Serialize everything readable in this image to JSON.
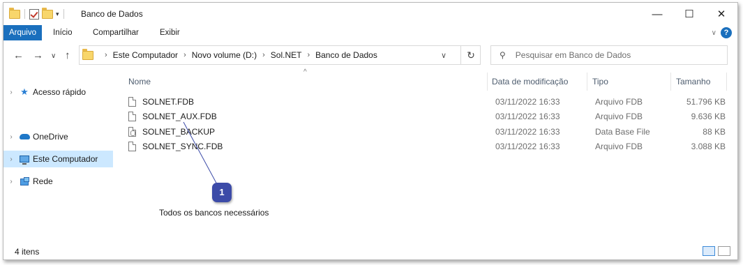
{
  "window": {
    "title": "Banco de Dados",
    "minimize_glyph": "—",
    "maximize_glyph": "☐",
    "close_glyph": "✕"
  },
  "ribbon": {
    "tabs": [
      "Arquivo",
      "Início",
      "Compartilhar",
      "Exibir"
    ],
    "active_tab": "Arquivo",
    "help_label": "?"
  },
  "nav": {
    "back_glyph": "←",
    "forward_glyph": "→",
    "recent_glyph": "∨",
    "up_glyph": "↑",
    "refresh_glyph": "↻",
    "breadcrumb": [
      "Este Computador",
      "Novo volume (D:)",
      "Sol.NET",
      "Banco de Dados"
    ],
    "search_placeholder": "Pesquisar em Banco de Dados"
  },
  "sidebar": {
    "items": [
      {
        "label": "Acesso rápido",
        "icon": "star-icon",
        "selected": false
      },
      {
        "label": "OneDrive",
        "icon": "cloud-icon",
        "selected": false
      },
      {
        "label": "Este Computador",
        "icon": "monitor-icon",
        "selected": true
      },
      {
        "label": "Rede",
        "icon": "network-icon",
        "selected": false
      }
    ]
  },
  "columns": {
    "name": "Nome",
    "date": "Data de modificação",
    "type": "Tipo",
    "size": "Tamanho"
  },
  "files": [
    {
      "name": "SOLNET.FDB",
      "date": "03/11/2022 16:33",
      "type": "Arquivo FDB",
      "size": "51.796 KB",
      "icon": "file-icon"
    },
    {
      "name": "SOLNET_AUX.FDB",
      "date": "03/11/2022 16:33",
      "type": "Arquivo FDB",
      "size": "9.636 KB",
      "icon": "file-icon"
    },
    {
      "name": "SOLNET_BACKUP",
      "date": "03/11/2022 16:33",
      "type": "Data Base File",
      "size": "88 KB",
      "icon": "database-file-icon"
    },
    {
      "name": "SOLNET_SYNC.FDB",
      "date": "03/11/2022 16:33",
      "type": "Arquivo FDB",
      "size": "3.088 KB",
      "icon": "file-icon"
    }
  ],
  "callout": {
    "number": "1",
    "text": "Todos os bancos necessários",
    "color": "#3c4ba8"
  },
  "status": {
    "item_count": "4 itens"
  },
  "colors": {
    "accent": "#1a6fbd",
    "selected": "#cce8ff"
  }
}
